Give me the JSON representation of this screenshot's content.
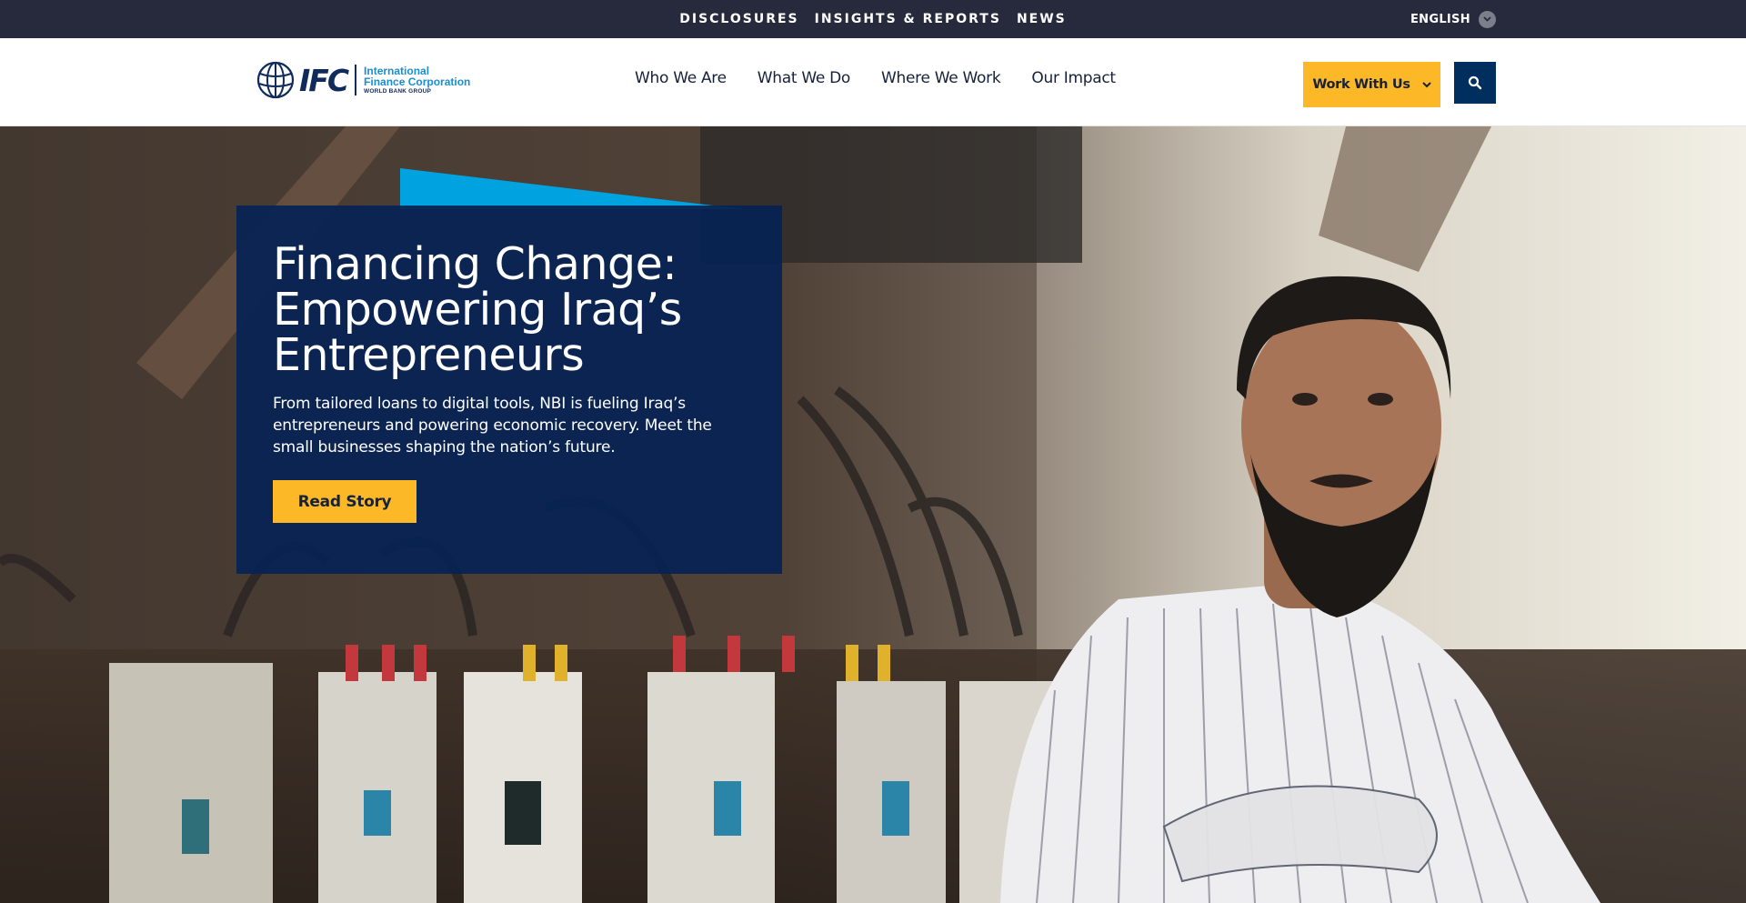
{
  "utility_bar": {
    "links": [
      "DISCLOSURES",
      "INSIGHTS & REPORTS",
      "NEWS"
    ],
    "language": "ENGLISH"
  },
  "header": {
    "logo": {
      "mark": "IFC",
      "line1": "International",
      "line2": "Finance Corporation",
      "line3": "WORLD BANK GROUP"
    },
    "nav": [
      "Who We Are",
      "What We Do",
      "Where We Work",
      "Our Impact"
    ],
    "cta_label": "Work With Us"
  },
  "hero": {
    "title": "Financing Change: Empowering Iraq’s Entrepreneurs",
    "description": "From tailored loans to digital tools, NBI is fueling Iraq’s entrepreneurs and powering economic recovery. Meet the small businesses shaping the nation’s future.",
    "button_label": "Read Story"
  },
  "colors": {
    "utility_bg": "#262a3c",
    "accent_yellow": "#fdb827",
    "navy": "#002f5f",
    "card_navy": "#062254",
    "accent_cyan": "#00a3e0"
  },
  "icons": {
    "language_toggle": "chevron-down-icon",
    "cta_dropdown": "chevron-down-icon",
    "search": "search-icon",
    "logo": "globe-icon"
  }
}
